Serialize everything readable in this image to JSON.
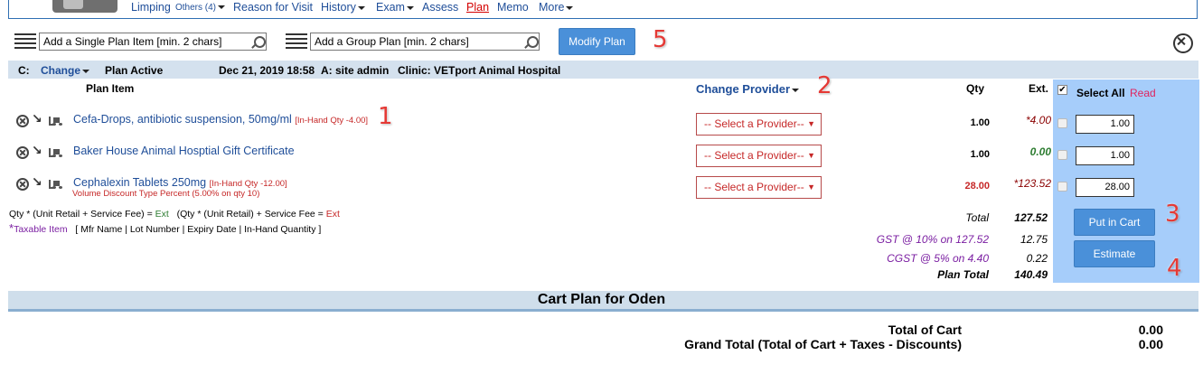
{
  "nav": {
    "items": [
      {
        "label": "Limping",
        "caret": false
      },
      {
        "label": "Others (4)",
        "caret": true
      },
      {
        "label": "Reason for Visit",
        "caret": false
      },
      {
        "label": "History",
        "caret": true
      },
      {
        "label": "Exam",
        "caret": true
      },
      {
        "label": "Assess",
        "caret": false
      },
      {
        "label": "Plan",
        "caret": false,
        "active": true
      },
      {
        "label": "Memo",
        "caret": false
      },
      {
        "label": "More",
        "caret": true
      }
    ]
  },
  "search": {
    "single_placeholder": "Add a Single Plan Item [min. 2 chars]",
    "group_placeholder": "Add a Group Plan [min. 2 chars]",
    "modify_label": "Modify Plan"
  },
  "info": {
    "c_label": "C:",
    "change_label": "Change",
    "status": "Plan Active",
    "datetime": "Dec 21, 2019 18:58",
    "admin": "A: site admin",
    "clinic": "Clinic: VETport Animal Hospital"
  },
  "headers": {
    "plan_item": "Plan Item",
    "change_provider": "Change Provider",
    "qty": "Qty",
    "ext": "Ext.",
    "select_all": "Select All",
    "read": "Read"
  },
  "items": [
    {
      "name": "Cefa-Drops, antibiotic suspension, 50mg/ml",
      "inhand": "[In-Hand Qty -4.00]",
      "note": "",
      "provider": "-- Select a Provider--",
      "qty": "1.00",
      "ext": "*4.00",
      "input": "1.00"
    },
    {
      "name": "Baker House Animal Hosptial Gift Certificate",
      "inhand": "",
      "note": "",
      "provider": "-- Select a Provider--",
      "qty": "1.00",
      "ext": "0.00",
      "input": "1.00"
    },
    {
      "name": "Cephalexin Tablets 250mg",
      "inhand": "[In-Hand Qty -12.00]",
      "note": "Volume Discount Type Percent (5.00% on qty 10)",
      "provider": "-- Select a Provider--",
      "qty": "28.00",
      "ext": "*123.52",
      "input": "28.00"
    }
  ],
  "legend": {
    "formula_a": "Qty * (Unit Retail + Service Fee) = ",
    "formula_a_ext": "Ext",
    "formula_b": "(Qty * (Unit Retail) + Service Fee = ",
    "formula_b_ext": "Ext",
    "taxable": "Taxable Item",
    "fields": "[ Mfr Name | Lot Number | Expiry Date | In-Hand Quantity ]"
  },
  "totals": [
    {
      "label": "Total",
      "value": "127.52"
    },
    {
      "label": "GST @ 10% on 127.52",
      "value": "12.75"
    },
    {
      "label": "CGST @ 5% on 4.40",
      "value": "0.22"
    },
    {
      "label": "Plan Total",
      "value": "140.49"
    }
  ],
  "buttons": {
    "put_in_cart": "Put in Cart",
    "estimate": "Estimate"
  },
  "markers": [
    "1",
    "2",
    "3",
    "4",
    "5"
  ],
  "cart": {
    "title": "Cart Plan for Oden",
    "total_label": "Total of Cart",
    "total_value": "0.00",
    "grand_label": "Grand Total (Total of Cart + Taxes - Discounts)",
    "grand_value": "0.00"
  },
  "colors": {
    "accent": "#4a90d9",
    "link": "#1f4e99",
    "alert": "#c62828",
    "panel": "#a6cdfa"
  }
}
